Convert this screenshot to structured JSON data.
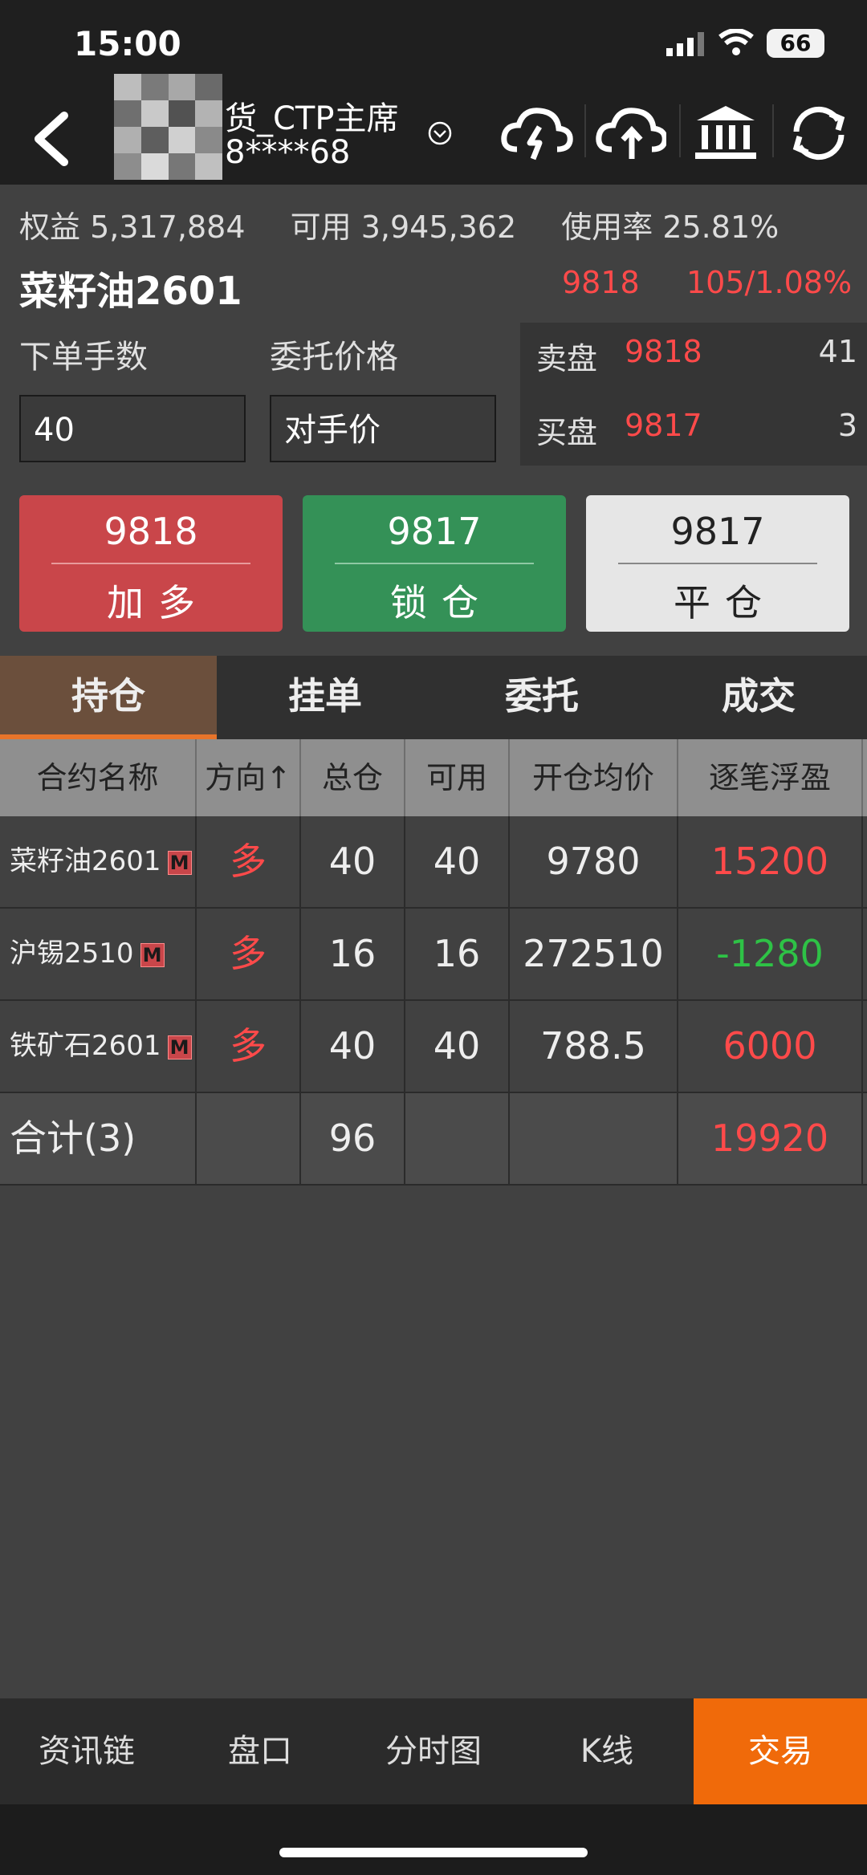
{
  "status": {
    "time": "15:00",
    "battery": "66"
  },
  "header": {
    "account_name": "货_CTP主席",
    "account_id": "8****68"
  },
  "account": {
    "equity_label": "权益",
    "equity": "5,317,884",
    "available_label": "可用",
    "available": "3,945,362",
    "usage_label": "使用率",
    "usage": "25.81%"
  },
  "symbol": {
    "name": "菜籽油2601",
    "last": "9818",
    "change": "105/1.08%"
  },
  "order": {
    "qty_label": "下单手数",
    "price_label": "委托价格",
    "qty_value": "40",
    "price_value": "对手价"
  },
  "book": {
    "ask_label": "卖盘",
    "ask_price": "9818",
    "ask_vol": "41",
    "bid_label": "买盘",
    "bid_price": "9817",
    "bid_vol": "3"
  },
  "actions": [
    {
      "price": "9818",
      "label": "加多"
    },
    {
      "price": "9817",
      "label": "锁仓"
    },
    {
      "price": "9817",
      "label": "平仓"
    }
  ],
  "tabs": [
    "持仓",
    "挂单",
    "委托",
    "成交"
  ],
  "table": {
    "headers": [
      "合约名称",
      "方向↑",
      "总仓",
      "可用",
      "开仓均价",
      "逐笔浮盈"
    ],
    "tag": "M",
    "rows": [
      {
        "name": "菜籽油2601",
        "dir": "多",
        "total": "40",
        "avail": "40",
        "avg": "9780",
        "pnl": "15200"
      },
      {
        "name": "沪锡2510",
        "dir": "多",
        "total": "16",
        "avail": "16",
        "avg": "272510",
        "pnl": "-1280"
      },
      {
        "name": "铁矿石2601",
        "dir": "多",
        "total": "40",
        "avail": "40",
        "avg": "788.5",
        "pnl": "6000"
      }
    ],
    "total_row": {
      "label": "合计(3)",
      "total": "96",
      "pnl": "19920"
    }
  },
  "nav": [
    "资讯链",
    "盘口",
    "分时图",
    "K线",
    "交易"
  ],
  "colors": {
    "up": "#ff4a4a",
    "down": "#2ec246",
    "accent": "#f06a0a"
  }
}
